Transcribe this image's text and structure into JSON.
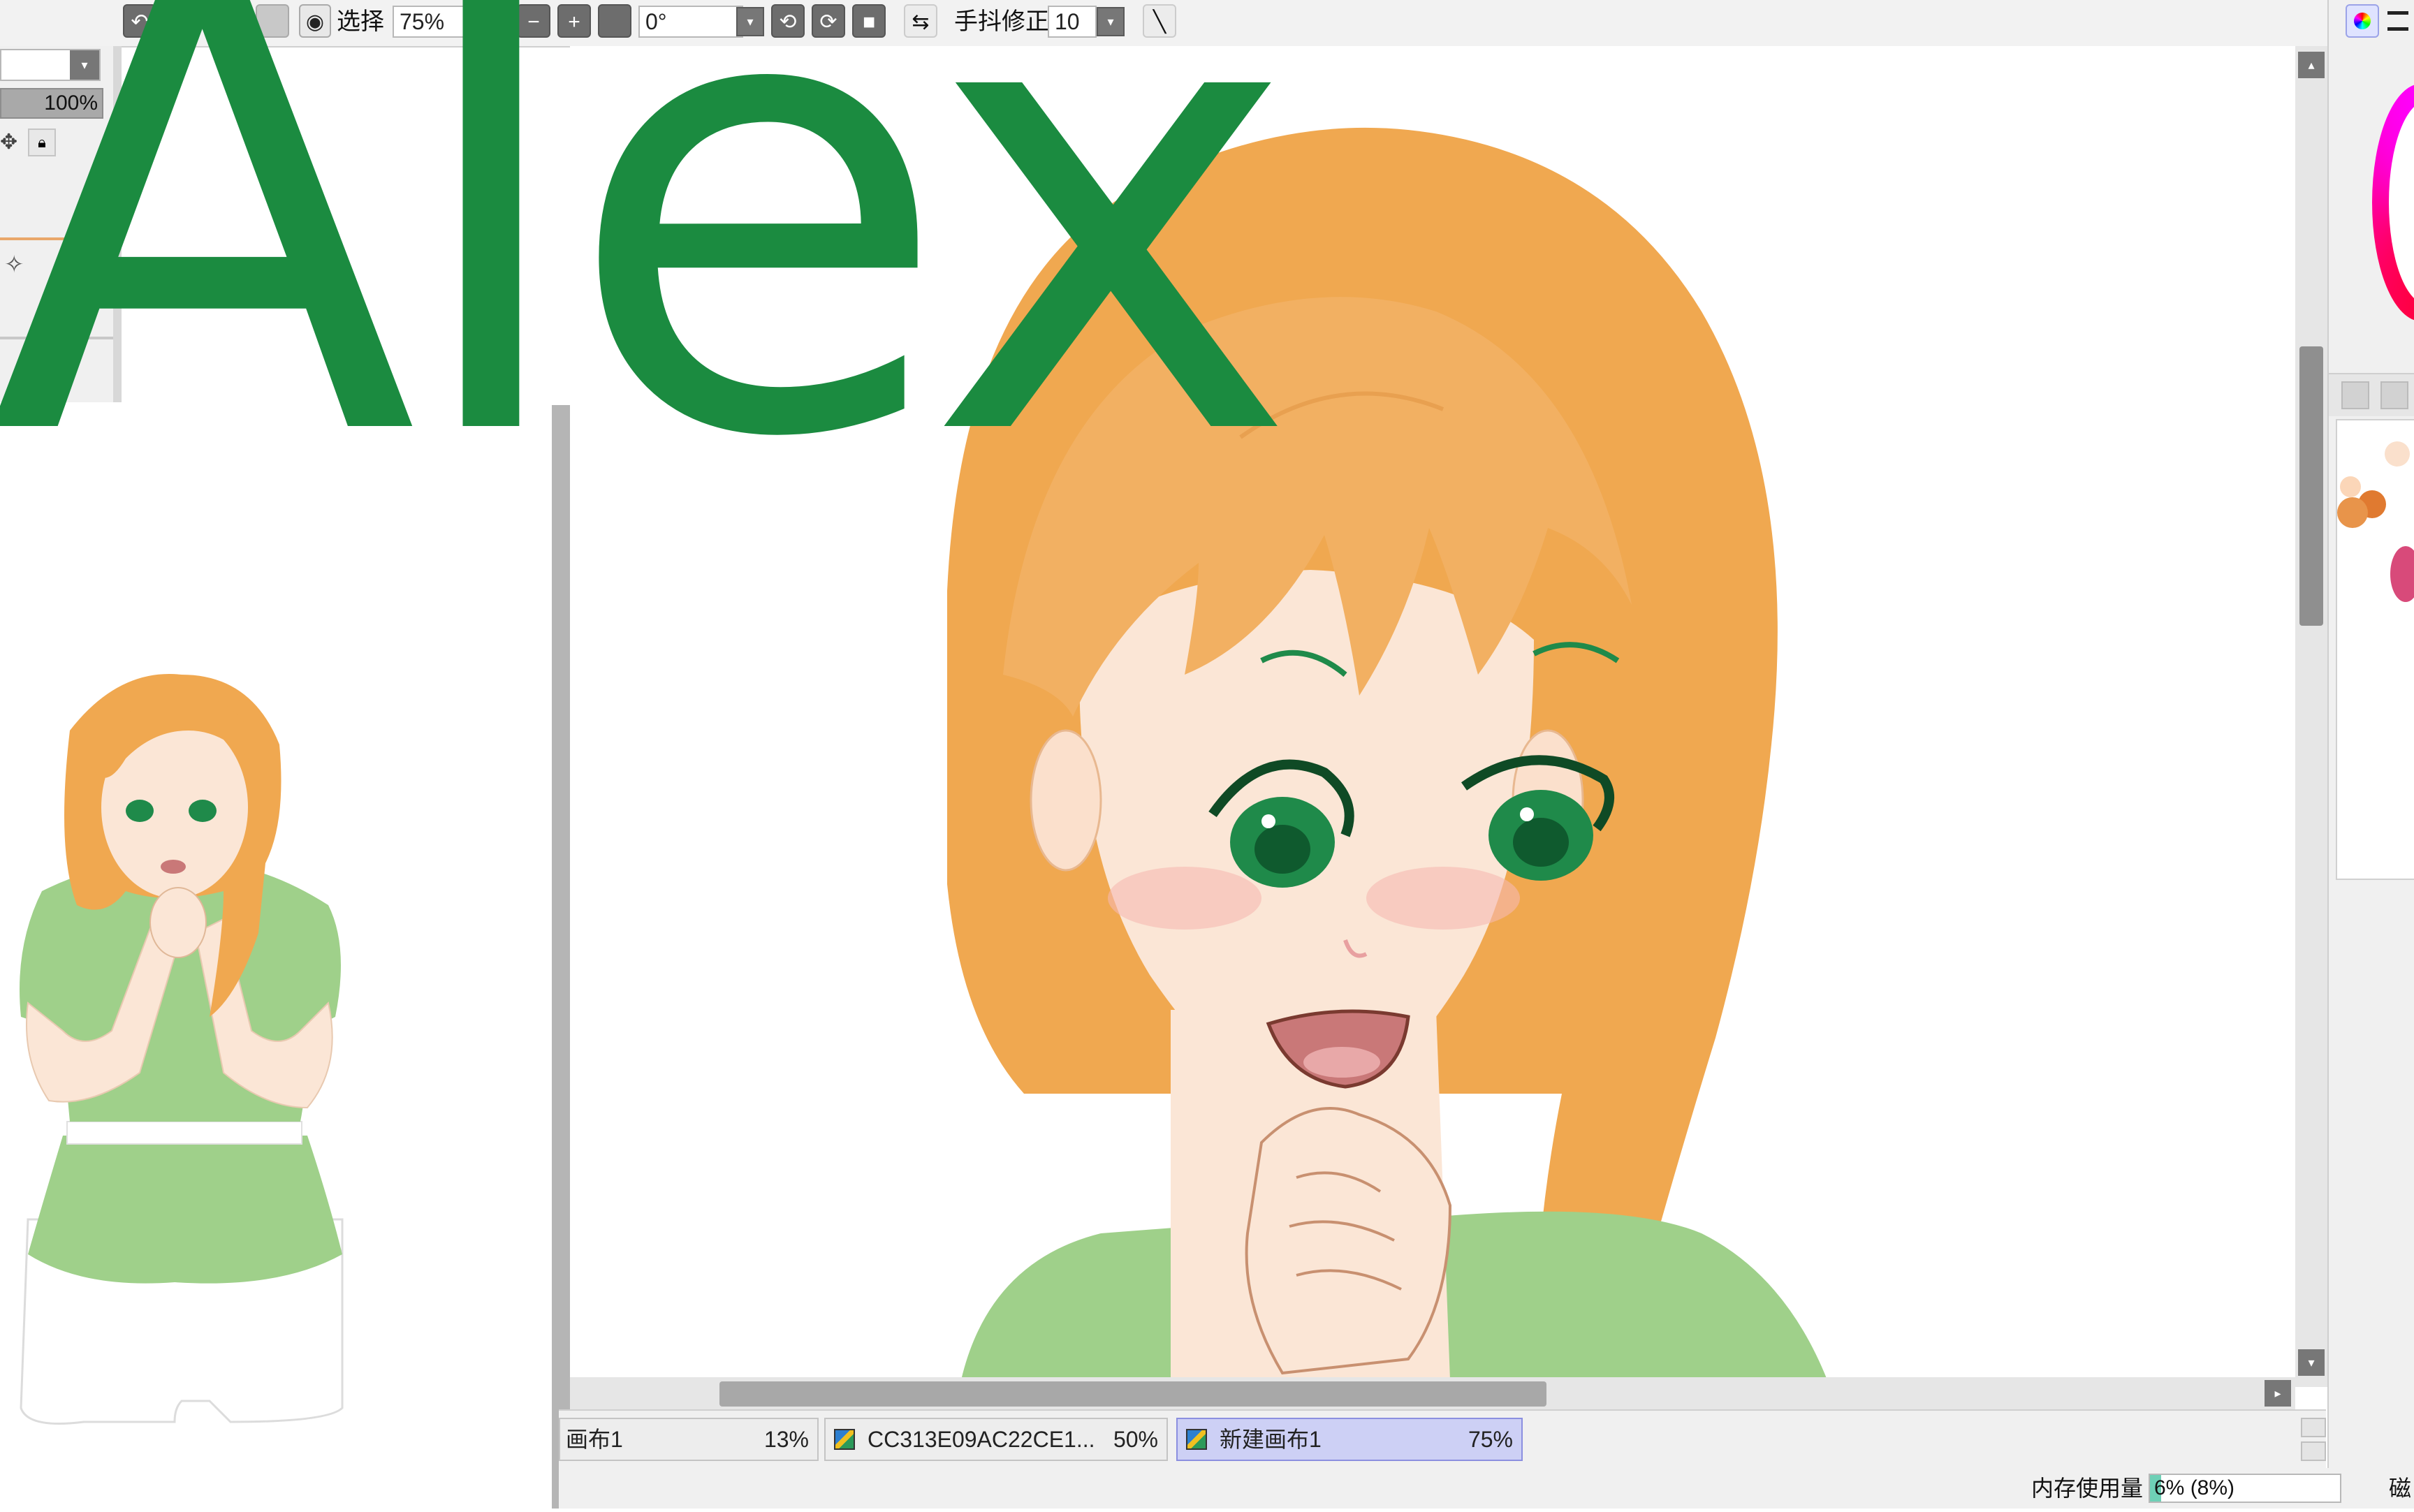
{
  "overlay": {
    "title": "Alex",
    "color": "#1b8b40"
  },
  "toolbar": {
    "view_icon": "eye-icon",
    "select_label": "选择",
    "zoom_value": "75%",
    "angle_value": "0°",
    "stabilizer_label": "手抖修正",
    "stabilizer_value": "10"
  },
  "left_panel": {
    "opacity_value": "100%"
  },
  "doc_tabs": [
    {
      "label": "画布1",
      "percent": "13%",
      "active": false
    },
    {
      "label": "CC313E09AC22CE1...",
      "percent": "50%",
      "active": false
    },
    {
      "label": "新建画布1",
      "percent": "75%",
      "active": true
    }
  ],
  "status": {
    "memory_label": "内存使用量",
    "memory_value": "6% (8%)",
    "memory_fraction": 0.06,
    "disk_label": "磁"
  },
  "colors": {
    "hair": "#f0a850",
    "shirt": "#9fd08a",
    "skin": "#fbe6d6",
    "eyes": "#1f8a4a",
    "accent_active_tab": "#cdd0f5"
  }
}
